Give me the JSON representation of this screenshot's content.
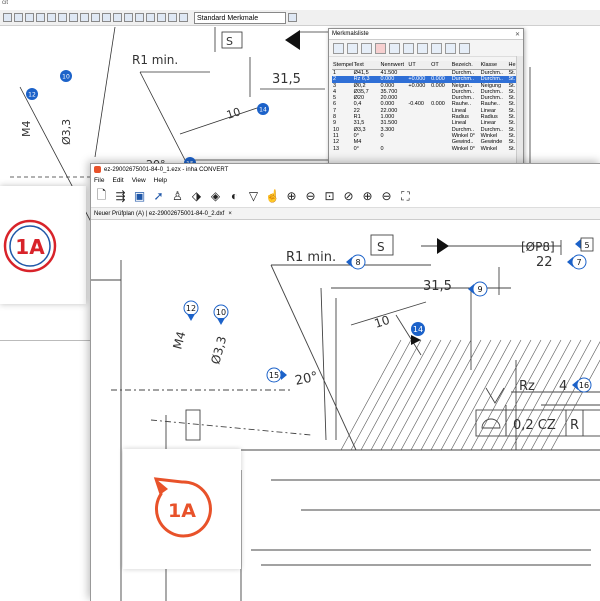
{
  "back_window": {
    "title_fragment": "cit",
    "standard_select": "Standard Merkmale",
    "drawing": {
      "label_r1": "R1 min.",
      "label_31_5": "31,5",
      "label_10": "10",
      "label_m4": "M4",
      "label_d33": "Ø3,3",
      "label_20": "20°",
      "label_s": "S",
      "label_dp8": "[ØP8]"
    },
    "balloons": [
      "12",
      "10",
      "14",
      "15"
    ]
  },
  "merkmal_window": {
    "title": "Merkmalsliste",
    "close": "✕",
    "columns": [
      "Stempel.",
      "Text",
      "Nennwert",
      "UT",
      "OT",
      "Bezeich.",
      "Klasse",
      "He"
    ],
    "rows": [
      [
        "1",
        "Ø41,5",
        "41.500",
        "",
        "",
        "Durchm..",
        "Durchm..",
        "St."
      ],
      [
        "2",
        "Rz 6,3",
        "0.000",
        "+0.000",
        "0.000",
        "Durchm..",
        "Durchm..",
        "St."
      ],
      [
        "3",
        "Ø0,2",
        "0.000",
        "+0.000",
        "0.000",
        "Neigun..",
        "Neigung",
        "St."
      ],
      [
        "4",
        "Ø35,7",
        "35.700",
        "",
        "",
        "Durchm..",
        "Durchm..",
        "St."
      ],
      [
        "5",
        "Ø20",
        "20.000",
        "",
        "",
        "Durchm..",
        "Durchm..",
        "St."
      ],
      [
        "6",
        "0,4",
        "0.000",
        "-0.400",
        "0.000",
        "Rauhe..",
        "Rauhe..",
        "St."
      ],
      [
        "7",
        "22",
        "22.000",
        "",
        "",
        "Lineal",
        "Linear",
        "St."
      ],
      [
        "8",
        "R1",
        "1.000",
        "",
        "",
        "Radius",
        "Radius",
        "St."
      ],
      [
        "9",
        "31,5",
        "31.500",
        "",
        "",
        "Lineal",
        "Linear",
        "St."
      ],
      [
        "10",
        "Ø3,3",
        "3.300",
        "",
        "",
        "Durchm..",
        "Durchm..",
        "St."
      ],
      [
        "11",
        "0°",
        "0",
        "",
        "",
        "Winkel 0°",
        "Winkel",
        "St."
      ],
      [
        "12",
        "M4",
        "",
        "",
        "",
        "Gewind..",
        "Gewinde",
        "St."
      ],
      [
        "13",
        "0°",
        "0",
        "",
        "",
        "Winkel 0°",
        "Winkel",
        "St."
      ]
    ]
  },
  "front_window": {
    "title": "ez-29002675001-84-0_1.ezx - inha CONVERT",
    "menu": [
      "File",
      "Edit",
      "View",
      "Help"
    ],
    "tab_label": "Neuer Prüfplan (A) | ez-29002675001-84-0_2.dxf",
    "tab_close": "×",
    "drawing": {
      "label_s": "S",
      "label_dp8": "[ØP8]",
      "label_r1": "R1 min.",
      "label_22": "22",
      "label_31_5": "31,5",
      "label_10": "10",
      "label_m4": "M4",
      "label_d33": "Ø3,3",
      "label_20": "20°",
      "label_rz": "Rz",
      "label_4": "4",
      "label_02cz": "0,2 CZ",
      "label_r": "R"
    },
    "balloons": [
      "5",
      "7",
      "8",
      "9",
      "12",
      "10",
      "14",
      "15",
      "16"
    ]
  },
  "logos": {
    "big": "1A",
    "small": "1A"
  },
  "colors": {
    "balloon_blue": "#1c62c9",
    "logo_orange": "#e8522a",
    "logo_red": "#d8232a",
    "logo_blue": "#1f57a8",
    "selection_blue": "#2f6fd6"
  }
}
